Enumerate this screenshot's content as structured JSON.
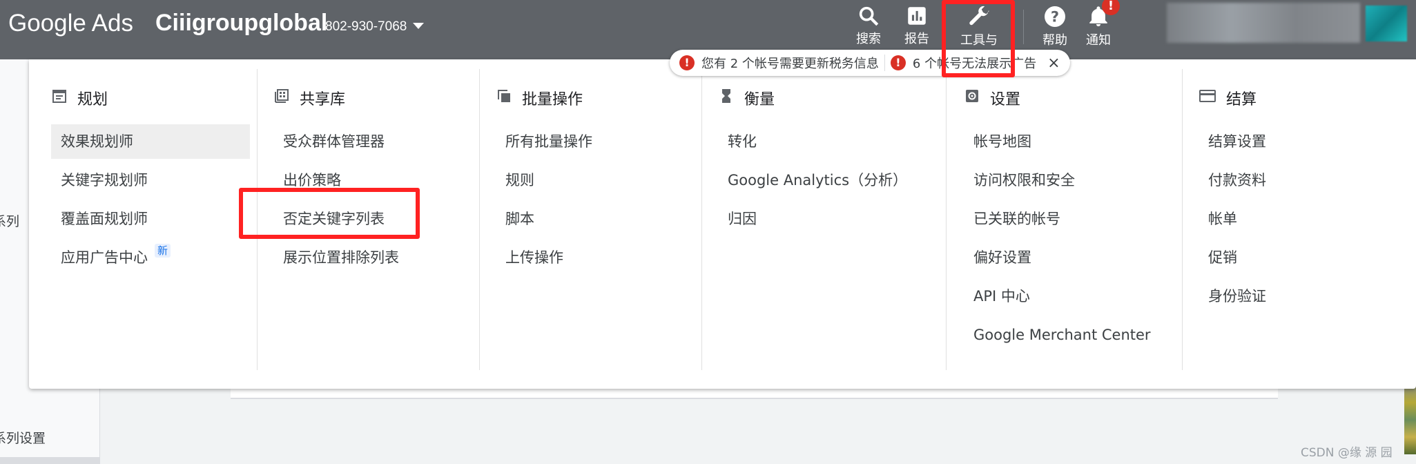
{
  "header": {
    "logo": "Google Ads",
    "account_name": "Ciiigroupglobal",
    "account_id": "802-930-7068",
    "nav": [
      {
        "label": "搜索",
        "icon": "search-icon"
      },
      {
        "label": "报告",
        "icon": "bar-chart-icon"
      },
      {
        "label": "工具与",
        "icon": "wrench-icon"
      },
      {
        "label": "帮助",
        "icon": "help-icon"
      },
      {
        "label": "通知",
        "icon": "bell-icon"
      }
    ],
    "notification_count": "!"
  },
  "notice": {
    "message1": "您有 2 个帐号需要更新税务信息",
    "message2": "6 个帐号无法展示广告",
    "close": "×"
  },
  "menu": {
    "columns": [
      {
        "title": "规划",
        "icon": "calendar-icon",
        "items": [
          "效果规划师",
          "关键字规划师",
          "覆盖面规划师",
          "应用广告中心"
        ],
        "new_badge": "新"
      },
      {
        "title": "共享库",
        "icon": "library-icon",
        "items": [
          "受众群体管理器",
          "出价策略",
          "否定关键字列表",
          "展示位置排除列表"
        ]
      },
      {
        "title": "批量操作",
        "icon": "copy-icon",
        "items": [
          "所有批量操作",
          "规则",
          "脚本",
          "上传操作"
        ]
      },
      {
        "title": "衡量",
        "icon": "hourglass-icon",
        "items": [
          "转化",
          "Google Analytics（分析）",
          "归因"
        ]
      },
      {
        "title": "设置",
        "icon": "settings-icon",
        "items": [
          "帐号地图",
          "访问权限和安全",
          "已关联的帐号",
          "偏好设置",
          "API 中心",
          "Google Merchant Center"
        ]
      },
      {
        "title": "结算",
        "icon": "credit-card-icon",
        "items": [
          "结算设置",
          "付款资料",
          "帐单",
          "促销",
          "身份验证"
        ]
      }
    ]
  },
  "background": {
    "side_items": [
      "系列",
      "系列设置"
    ],
    "watermark": "CSDN @缘 源 园"
  },
  "colors": {
    "topbar": "#5f6368",
    "highlight": "#ff2222",
    "accent": "#1a73e8"
  }
}
